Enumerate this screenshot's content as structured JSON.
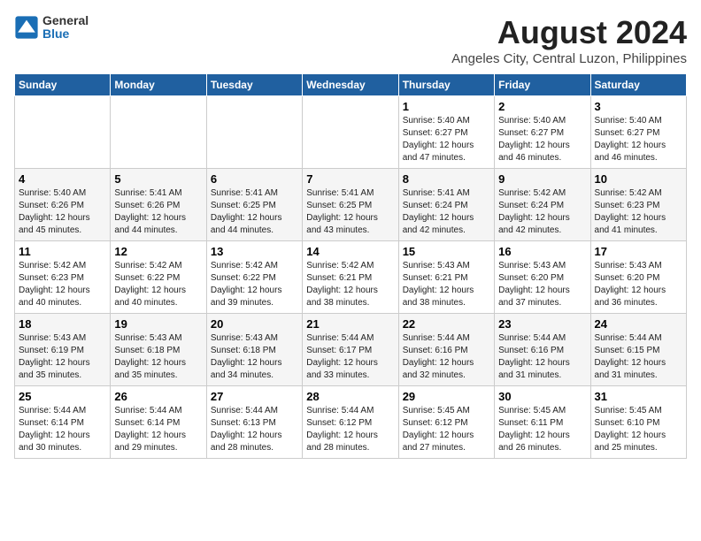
{
  "logo": {
    "general": "General",
    "blue": "Blue"
  },
  "title": "August 2024",
  "subtitle": "Angeles City, Central Luzon, Philippines",
  "headers": [
    "Sunday",
    "Monday",
    "Tuesday",
    "Wednesday",
    "Thursday",
    "Friday",
    "Saturday"
  ],
  "weeks": [
    [
      {
        "day": "",
        "info": ""
      },
      {
        "day": "",
        "info": ""
      },
      {
        "day": "",
        "info": ""
      },
      {
        "day": "",
        "info": ""
      },
      {
        "day": "1",
        "info": "Sunrise: 5:40 AM\nSunset: 6:27 PM\nDaylight: 12 hours\nand 47 minutes."
      },
      {
        "day": "2",
        "info": "Sunrise: 5:40 AM\nSunset: 6:27 PM\nDaylight: 12 hours\nand 46 minutes."
      },
      {
        "day": "3",
        "info": "Sunrise: 5:40 AM\nSunset: 6:27 PM\nDaylight: 12 hours\nand 46 minutes."
      }
    ],
    [
      {
        "day": "4",
        "info": "Sunrise: 5:40 AM\nSunset: 6:26 PM\nDaylight: 12 hours\nand 45 minutes."
      },
      {
        "day": "5",
        "info": "Sunrise: 5:41 AM\nSunset: 6:26 PM\nDaylight: 12 hours\nand 44 minutes."
      },
      {
        "day": "6",
        "info": "Sunrise: 5:41 AM\nSunset: 6:25 PM\nDaylight: 12 hours\nand 44 minutes."
      },
      {
        "day": "7",
        "info": "Sunrise: 5:41 AM\nSunset: 6:25 PM\nDaylight: 12 hours\nand 43 minutes."
      },
      {
        "day": "8",
        "info": "Sunrise: 5:41 AM\nSunset: 6:24 PM\nDaylight: 12 hours\nand 42 minutes."
      },
      {
        "day": "9",
        "info": "Sunrise: 5:42 AM\nSunset: 6:24 PM\nDaylight: 12 hours\nand 42 minutes."
      },
      {
        "day": "10",
        "info": "Sunrise: 5:42 AM\nSunset: 6:23 PM\nDaylight: 12 hours\nand 41 minutes."
      }
    ],
    [
      {
        "day": "11",
        "info": "Sunrise: 5:42 AM\nSunset: 6:23 PM\nDaylight: 12 hours\nand 40 minutes."
      },
      {
        "day": "12",
        "info": "Sunrise: 5:42 AM\nSunset: 6:22 PM\nDaylight: 12 hours\nand 40 minutes."
      },
      {
        "day": "13",
        "info": "Sunrise: 5:42 AM\nSunset: 6:22 PM\nDaylight: 12 hours\nand 39 minutes."
      },
      {
        "day": "14",
        "info": "Sunrise: 5:42 AM\nSunset: 6:21 PM\nDaylight: 12 hours\nand 38 minutes."
      },
      {
        "day": "15",
        "info": "Sunrise: 5:43 AM\nSunset: 6:21 PM\nDaylight: 12 hours\nand 38 minutes."
      },
      {
        "day": "16",
        "info": "Sunrise: 5:43 AM\nSunset: 6:20 PM\nDaylight: 12 hours\nand 37 minutes."
      },
      {
        "day": "17",
        "info": "Sunrise: 5:43 AM\nSunset: 6:20 PM\nDaylight: 12 hours\nand 36 minutes."
      }
    ],
    [
      {
        "day": "18",
        "info": "Sunrise: 5:43 AM\nSunset: 6:19 PM\nDaylight: 12 hours\nand 35 minutes."
      },
      {
        "day": "19",
        "info": "Sunrise: 5:43 AM\nSunset: 6:18 PM\nDaylight: 12 hours\nand 35 minutes."
      },
      {
        "day": "20",
        "info": "Sunrise: 5:43 AM\nSunset: 6:18 PM\nDaylight: 12 hours\nand 34 minutes."
      },
      {
        "day": "21",
        "info": "Sunrise: 5:44 AM\nSunset: 6:17 PM\nDaylight: 12 hours\nand 33 minutes."
      },
      {
        "day": "22",
        "info": "Sunrise: 5:44 AM\nSunset: 6:16 PM\nDaylight: 12 hours\nand 32 minutes."
      },
      {
        "day": "23",
        "info": "Sunrise: 5:44 AM\nSunset: 6:16 PM\nDaylight: 12 hours\nand 31 minutes."
      },
      {
        "day": "24",
        "info": "Sunrise: 5:44 AM\nSunset: 6:15 PM\nDaylight: 12 hours\nand 31 minutes."
      }
    ],
    [
      {
        "day": "25",
        "info": "Sunrise: 5:44 AM\nSunset: 6:14 PM\nDaylight: 12 hours\nand 30 minutes."
      },
      {
        "day": "26",
        "info": "Sunrise: 5:44 AM\nSunset: 6:14 PM\nDaylight: 12 hours\nand 29 minutes."
      },
      {
        "day": "27",
        "info": "Sunrise: 5:44 AM\nSunset: 6:13 PM\nDaylight: 12 hours\nand 28 minutes."
      },
      {
        "day": "28",
        "info": "Sunrise: 5:44 AM\nSunset: 6:12 PM\nDaylight: 12 hours\nand 28 minutes."
      },
      {
        "day": "29",
        "info": "Sunrise: 5:45 AM\nSunset: 6:12 PM\nDaylight: 12 hours\nand 27 minutes."
      },
      {
        "day": "30",
        "info": "Sunrise: 5:45 AM\nSunset: 6:11 PM\nDaylight: 12 hours\nand 26 minutes."
      },
      {
        "day": "31",
        "info": "Sunrise: 5:45 AM\nSunset: 6:10 PM\nDaylight: 12 hours\nand 25 minutes."
      }
    ]
  ]
}
